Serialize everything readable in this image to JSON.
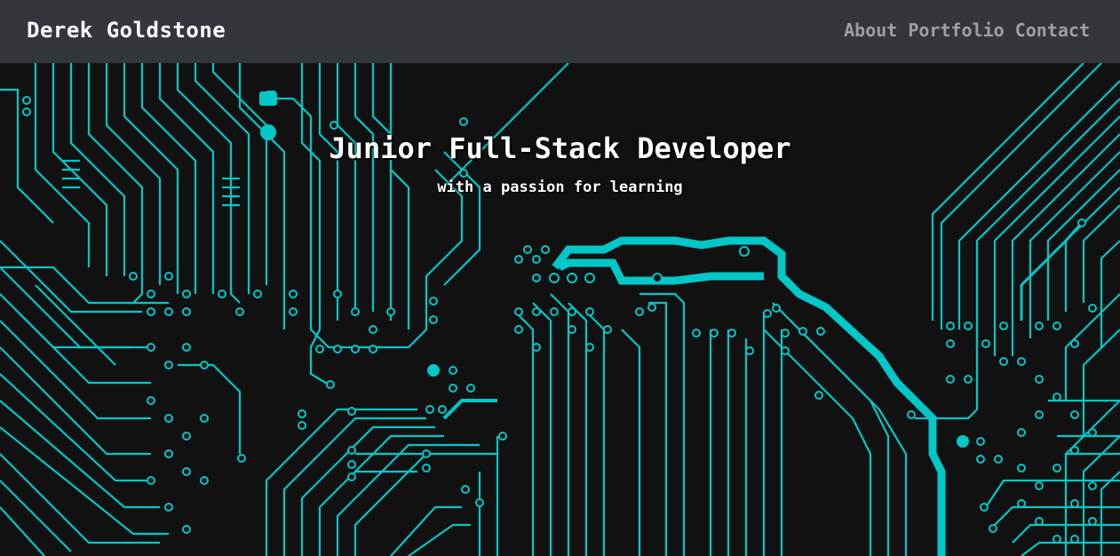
{
  "nav": {
    "brand": "Derek Goldstone",
    "links": [
      "About",
      "Portfolio",
      "Contact"
    ]
  },
  "hero": {
    "title": "Junior Full-Stack Developer",
    "subtitle": "with a passion for learning",
    "background": "circuit-board-pattern"
  },
  "colors": {
    "navbar": "#33373c",
    "nav_link": "#9c9fa3",
    "brand": "#ffffff",
    "background": "#111111",
    "circuit": "#00c8c8"
  }
}
